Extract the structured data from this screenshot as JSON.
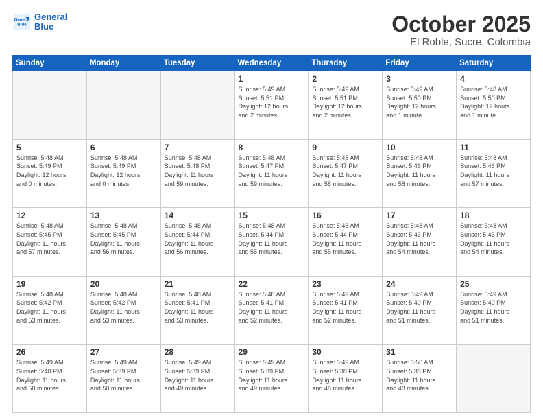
{
  "header": {
    "logo_line1": "General",
    "logo_line2": "Blue",
    "title": "October 2025",
    "subtitle": "El Roble, Sucre, Colombia"
  },
  "weekdays": [
    "Sunday",
    "Monday",
    "Tuesday",
    "Wednesday",
    "Thursday",
    "Friday",
    "Saturday"
  ],
  "weeks": [
    [
      {
        "day": "",
        "info": ""
      },
      {
        "day": "",
        "info": ""
      },
      {
        "day": "",
        "info": ""
      },
      {
        "day": "1",
        "info": "Sunrise: 5:49 AM\nSunset: 5:51 PM\nDaylight: 12 hours\nand 2 minutes."
      },
      {
        "day": "2",
        "info": "Sunrise: 5:49 AM\nSunset: 5:51 PM\nDaylight: 12 hours\nand 2 minutes."
      },
      {
        "day": "3",
        "info": "Sunrise: 5:49 AM\nSunset: 5:50 PM\nDaylight: 12 hours\nand 1 minute."
      },
      {
        "day": "4",
        "info": "Sunrise: 5:48 AM\nSunset: 5:50 PM\nDaylight: 12 hours\nand 1 minute."
      }
    ],
    [
      {
        "day": "5",
        "info": "Sunrise: 5:48 AM\nSunset: 5:49 PM\nDaylight: 12 hours\nand 0 minutes."
      },
      {
        "day": "6",
        "info": "Sunrise: 5:48 AM\nSunset: 5:49 PM\nDaylight: 12 hours\nand 0 minutes."
      },
      {
        "day": "7",
        "info": "Sunrise: 5:48 AM\nSunset: 5:48 PM\nDaylight: 11 hours\nand 59 minutes."
      },
      {
        "day": "8",
        "info": "Sunrise: 5:48 AM\nSunset: 5:47 PM\nDaylight: 11 hours\nand 59 minutes."
      },
      {
        "day": "9",
        "info": "Sunrise: 5:48 AM\nSunset: 5:47 PM\nDaylight: 11 hours\nand 58 minutes."
      },
      {
        "day": "10",
        "info": "Sunrise: 5:48 AM\nSunset: 5:46 PM\nDaylight: 11 hours\nand 58 minutes."
      },
      {
        "day": "11",
        "info": "Sunrise: 5:48 AM\nSunset: 5:46 PM\nDaylight: 11 hours\nand 57 minutes."
      }
    ],
    [
      {
        "day": "12",
        "info": "Sunrise: 5:48 AM\nSunset: 5:45 PM\nDaylight: 11 hours\nand 57 minutes."
      },
      {
        "day": "13",
        "info": "Sunrise: 5:48 AM\nSunset: 5:45 PM\nDaylight: 11 hours\nand 56 minutes."
      },
      {
        "day": "14",
        "info": "Sunrise: 5:48 AM\nSunset: 5:44 PM\nDaylight: 11 hours\nand 56 minutes."
      },
      {
        "day": "15",
        "info": "Sunrise: 5:48 AM\nSunset: 5:44 PM\nDaylight: 11 hours\nand 55 minutes."
      },
      {
        "day": "16",
        "info": "Sunrise: 5:48 AM\nSunset: 5:44 PM\nDaylight: 11 hours\nand 55 minutes."
      },
      {
        "day": "17",
        "info": "Sunrise: 5:48 AM\nSunset: 5:43 PM\nDaylight: 11 hours\nand 54 minutes."
      },
      {
        "day": "18",
        "info": "Sunrise: 5:48 AM\nSunset: 5:43 PM\nDaylight: 11 hours\nand 54 minutes."
      }
    ],
    [
      {
        "day": "19",
        "info": "Sunrise: 5:48 AM\nSunset: 5:42 PM\nDaylight: 11 hours\nand 53 minutes."
      },
      {
        "day": "20",
        "info": "Sunrise: 5:48 AM\nSunset: 5:42 PM\nDaylight: 11 hours\nand 53 minutes."
      },
      {
        "day": "21",
        "info": "Sunrise: 5:48 AM\nSunset: 5:41 PM\nDaylight: 11 hours\nand 53 minutes."
      },
      {
        "day": "22",
        "info": "Sunrise: 5:48 AM\nSunset: 5:41 PM\nDaylight: 11 hours\nand 52 minutes."
      },
      {
        "day": "23",
        "info": "Sunrise: 5:49 AM\nSunset: 5:41 PM\nDaylight: 11 hours\nand 52 minutes."
      },
      {
        "day": "24",
        "info": "Sunrise: 5:49 AM\nSunset: 5:40 PM\nDaylight: 11 hours\nand 51 minutes."
      },
      {
        "day": "25",
        "info": "Sunrise: 5:49 AM\nSunset: 5:40 PM\nDaylight: 11 hours\nand 51 minutes."
      }
    ],
    [
      {
        "day": "26",
        "info": "Sunrise: 5:49 AM\nSunset: 5:40 PM\nDaylight: 11 hours\nand 50 minutes."
      },
      {
        "day": "27",
        "info": "Sunrise: 5:49 AM\nSunset: 5:39 PM\nDaylight: 11 hours\nand 50 minutes."
      },
      {
        "day": "28",
        "info": "Sunrise: 5:49 AM\nSunset: 5:39 PM\nDaylight: 11 hours\nand 49 minutes."
      },
      {
        "day": "29",
        "info": "Sunrise: 5:49 AM\nSunset: 5:39 PM\nDaylight: 11 hours\nand 49 minutes."
      },
      {
        "day": "30",
        "info": "Sunrise: 5:49 AM\nSunset: 5:38 PM\nDaylight: 11 hours\nand 48 minutes."
      },
      {
        "day": "31",
        "info": "Sunrise: 5:50 AM\nSunset: 5:38 PM\nDaylight: 11 hours\nand 48 minutes."
      },
      {
        "day": "",
        "info": ""
      }
    ]
  ]
}
